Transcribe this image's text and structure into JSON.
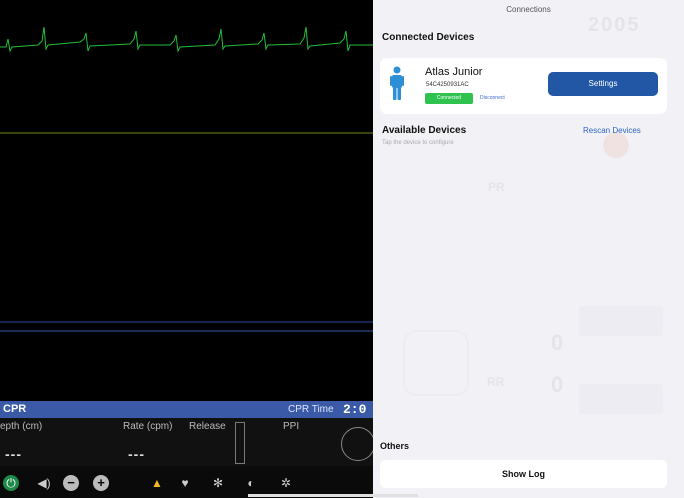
{
  "monitor": {
    "cpr_label": "CPR",
    "cpr_time_label": "CPR Time",
    "cpr_time_value": "2:0",
    "metrics": [
      {
        "label": "epth (cm)",
        "value": "---"
      },
      {
        "label": "Rate (cpm)",
        "value": "---"
      },
      {
        "label": "Release",
        "value": ""
      },
      {
        "label": "PPI",
        "value": ""
      }
    ],
    "toolbar_icons": [
      "power-icon",
      "speaker-icon",
      "minus-icon",
      "plus-icon",
      "bell-icon",
      "heart-icon",
      "snowflake-icon",
      "contrast-icon",
      "gear-icon"
    ],
    "colors": {
      "ecg": "#1fbf3a",
      "waveform2": "#6b8d1a",
      "waveform3": "#3a5aa8",
      "cpr_bar": "#3a5aa8"
    }
  },
  "panel": {
    "title": "Connections",
    "connected_header": "Connected Devices",
    "device": {
      "name": "Atlas Junior",
      "serial": "54C4250931AC",
      "status": "Connected",
      "disconnect": "Disconnect",
      "settings": "Settings"
    },
    "available_header": "Available Devices",
    "available_hint": "Tap the device to configure",
    "rescan": "Rescan Devices",
    "others_header": "Others",
    "show_log": "Show Log",
    "colors": {
      "accent": "#2257a6",
      "connected": "#2fc24e",
      "link": "#2b64c8"
    }
  }
}
